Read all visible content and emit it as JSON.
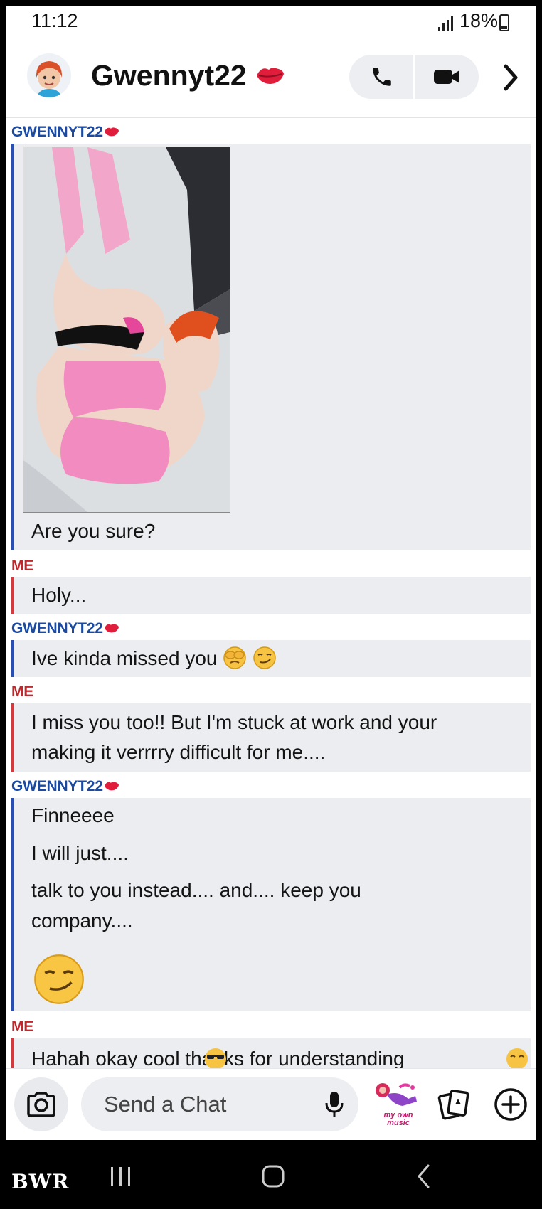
{
  "status_bar": {
    "time": "11:12",
    "battery": "18%"
  },
  "header": {
    "title": "Gwennyt22",
    "title_icon": "kiss-lips-icon",
    "actions": [
      "phone-icon",
      "video-icon",
      "chevron-right-icon"
    ]
  },
  "conversation": [
    {
      "sender": "GWENNYT22",
      "side": "them",
      "attachment": "photo",
      "lines": [
        "Are you sure?"
      ]
    },
    {
      "sender": "ME",
      "side": "me",
      "lines": [
        "Holy..."
      ]
    },
    {
      "sender": "GWENNYT22",
      "side": "them",
      "lines": [
        "Ive kinda missed you"
      ],
      "emoji": [
        "see-no-evil-monkey-emoji",
        "smirk-emoji"
      ]
    },
    {
      "sender": "ME",
      "side": "me",
      "lines": [
        "I miss you too!! But I'm stuck at work and your",
        "making it verrrry difficult for me...."
      ]
    },
    {
      "sender": "GWENNYT22",
      "side": "them",
      "lines": [
        "Finneeee",
        "I will just....",
        "talk to you instead.... and.... keep you",
        "company...."
      ],
      "emoji": [
        "smirk-emoji"
      ]
    },
    {
      "sender": "ME",
      "side": "me",
      "lines": [
        "Hahah okay cool  thanks for understanding"
      ],
      "emoji": [
        "sunglasses-emoji",
        "grin-emoji"
      ]
    }
  ],
  "composer": {
    "placeholder": "Send a Chat",
    "bitmoji_label": "my own music",
    "icons": [
      "camera-icon",
      "microphone-icon",
      "bitmoji-icon",
      "cards-icon",
      "plus-icon"
    ]
  },
  "nav_bar": {
    "watermark": "BWR",
    "buttons": [
      "recents-icon",
      "home-icon",
      "back-icon"
    ]
  },
  "colors": {
    "them": "#1b4aa3",
    "me": "#c4272b",
    "bubble": "#ebedf0",
    "accent_red": "#e01d3a"
  }
}
